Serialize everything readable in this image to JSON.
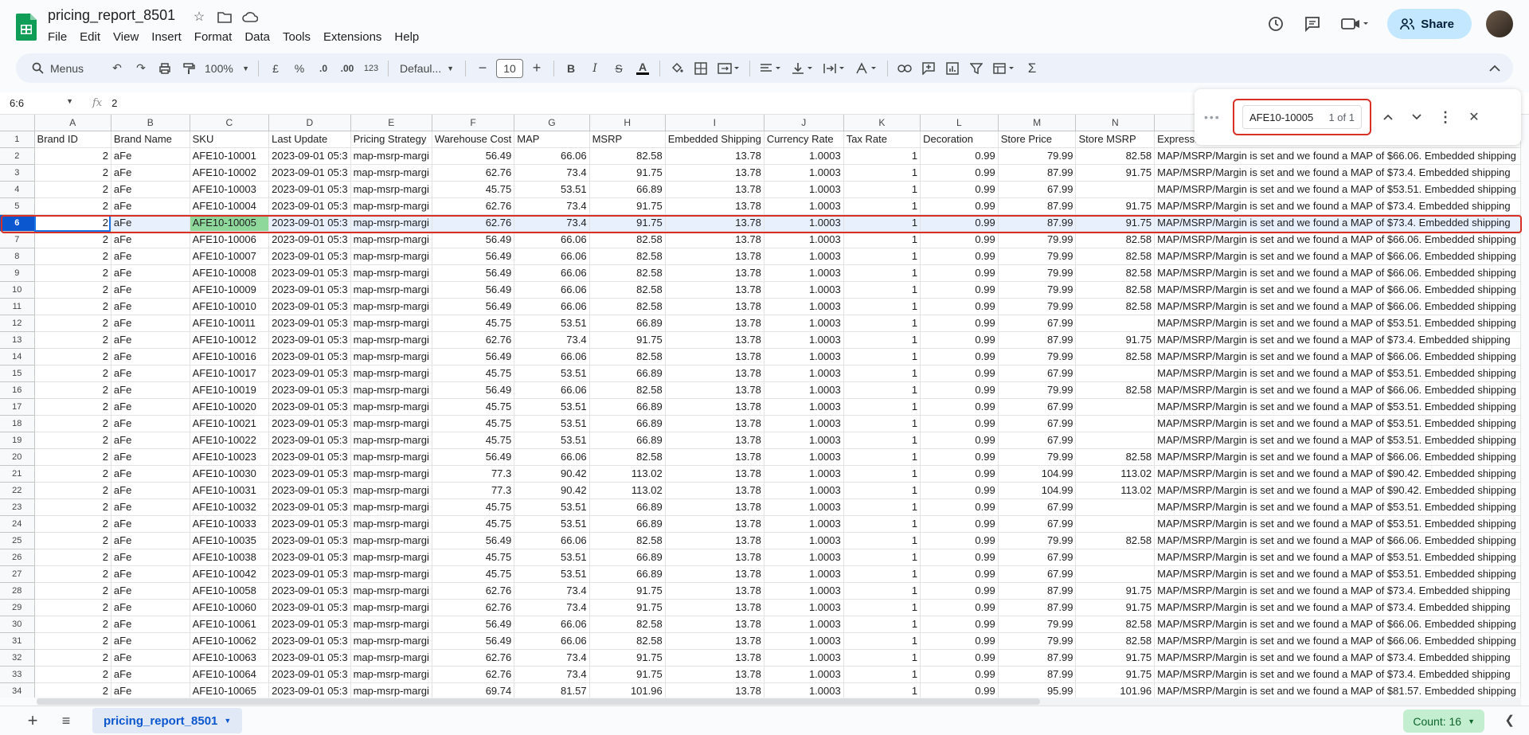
{
  "doc": {
    "title": "pricing_report_8501"
  },
  "menu": [
    "File",
    "Edit",
    "View",
    "Insert",
    "Format",
    "Data",
    "Tools",
    "Extensions",
    "Help"
  ],
  "header": {
    "share_label": "Share"
  },
  "toolbar": {
    "search_label": "Menus",
    "zoom": "100%",
    "currency": "£",
    "percent": "%",
    "dec_dec": ".0",
    "dec_inc": ".00",
    "number_format": "123",
    "font": "Defaul...",
    "font_size": "10"
  },
  "formula": {
    "namebox": "6:6",
    "fx": "fx",
    "value": "2"
  },
  "find": {
    "query": "AFE10-10005",
    "count": "1 of 1"
  },
  "columns": [
    "A",
    "B",
    "C",
    "D",
    "E",
    "F",
    "G",
    "H",
    "I",
    "J",
    "K",
    "L",
    "M",
    "N",
    "O"
  ],
  "header_row": [
    "Brand ID",
    "Brand Name",
    "SKU",
    "Last Update",
    "Pricing Strategy",
    "Warehouse Cost",
    "MAP",
    "MSRP",
    "Embedded Shipping",
    "Currency Rate",
    "Tax Rate",
    "Decoration",
    "Store Price",
    "Store MSRP",
    "Expression"
  ],
  "rows": [
    {
      "n": "2",
      "sku": "AFE10-10001",
      "wc": "56.49",
      "map": "66.06",
      "msrp": "82.58",
      "sp": "79.99",
      "sm": "82.58",
      "ex": "MAP/MSRP/Margin is set and we found a MAP of $66.06. Embedded shipping"
    },
    {
      "n": "3",
      "sku": "AFE10-10002",
      "wc": "62.76",
      "map": "73.4",
      "msrp": "91.75",
      "sp": "87.99",
      "sm": "91.75",
      "ex": "MAP/MSRP/Margin is set and we found a MAP of $73.4. Embedded shipping"
    },
    {
      "n": "4",
      "sku": "AFE10-10003",
      "wc": "45.75",
      "map": "53.51",
      "msrp": "66.89",
      "sp": "67.99",
      "sm": "",
      "ex": "MAP/MSRP/Margin is set and we found a MAP of $53.51. Embedded shipping"
    },
    {
      "n": "5",
      "sku": "AFE10-10004",
      "wc": "62.76",
      "map": "73.4",
      "msrp": "91.75",
      "sp": "87.99",
      "sm": "91.75",
      "ex": "MAP/MSRP/Margin is set and we found a MAP of $73.4. Embedded shipping"
    },
    {
      "n": "6",
      "sku": "AFE10-10005",
      "wc": "62.76",
      "map": "73.4",
      "msrp": "91.75",
      "sp": "87.99",
      "sm": "91.75",
      "ex": "MAP/MSRP/Margin is set and we found a MAP of $73.4. Embedded shipping"
    },
    {
      "n": "7",
      "sku": "AFE10-10006",
      "wc": "56.49",
      "map": "66.06",
      "msrp": "82.58",
      "sp": "79.99",
      "sm": "82.58",
      "ex": "MAP/MSRP/Margin is set and we found a MAP of $66.06. Embedded shipping"
    },
    {
      "n": "8",
      "sku": "AFE10-10007",
      "wc": "56.49",
      "map": "66.06",
      "msrp": "82.58",
      "sp": "79.99",
      "sm": "82.58",
      "ex": "MAP/MSRP/Margin is set and we found a MAP of $66.06. Embedded shipping"
    },
    {
      "n": "9",
      "sku": "AFE10-10008",
      "wc": "56.49",
      "map": "66.06",
      "msrp": "82.58",
      "sp": "79.99",
      "sm": "82.58",
      "ex": "MAP/MSRP/Margin is set and we found a MAP of $66.06. Embedded shipping"
    },
    {
      "n": "10",
      "sku": "AFE10-10009",
      "wc": "56.49",
      "map": "66.06",
      "msrp": "82.58",
      "sp": "79.99",
      "sm": "82.58",
      "ex": "MAP/MSRP/Margin is set and we found a MAP of $66.06. Embedded shipping"
    },
    {
      "n": "11",
      "sku": "AFE10-10010",
      "wc": "56.49",
      "map": "66.06",
      "msrp": "82.58",
      "sp": "79.99",
      "sm": "82.58",
      "ex": "MAP/MSRP/Margin is set and we found a MAP of $66.06. Embedded shipping"
    },
    {
      "n": "12",
      "sku": "AFE10-10011",
      "wc": "45.75",
      "map": "53.51",
      "msrp": "66.89",
      "sp": "67.99",
      "sm": "",
      "ex": "MAP/MSRP/Margin is set and we found a MAP of $53.51. Embedded shipping"
    },
    {
      "n": "13",
      "sku": "AFE10-10012",
      "wc": "62.76",
      "map": "73.4",
      "msrp": "91.75",
      "sp": "87.99",
      "sm": "91.75",
      "ex": "MAP/MSRP/Margin is set and we found a MAP of $73.4. Embedded shipping"
    },
    {
      "n": "14",
      "sku": "AFE10-10016",
      "wc": "56.49",
      "map": "66.06",
      "msrp": "82.58",
      "sp": "79.99",
      "sm": "82.58",
      "ex": "MAP/MSRP/Margin is set and we found a MAP of $66.06. Embedded shipping"
    },
    {
      "n": "15",
      "sku": "AFE10-10017",
      "wc": "45.75",
      "map": "53.51",
      "msrp": "66.89",
      "sp": "67.99",
      "sm": "",
      "ex": "MAP/MSRP/Margin is set and we found a MAP of $53.51. Embedded shipping"
    },
    {
      "n": "16",
      "sku": "AFE10-10019",
      "wc": "56.49",
      "map": "66.06",
      "msrp": "82.58",
      "sp": "79.99",
      "sm": "82.58",
      "ex": "MAP/MSRP/Margin is set and we found a MAP of $66.06. Embedded shipping"
    },
    {
      "n": "17",
      "sku": "AFE10-10020",
      "wc": "45.75",
      "map": "53.51",
      "msrp": "66.89",
      "sp": "67.99",
      "sm": "",
      "ex": "MAP/MSRP/Margin is set and we found a MAP of $53.51. Embedded shipping"
    },
    {
      "n": "18",
      "sku": "AFE10-10021",
      "wc": "45.75",
      "map": "53.51",
      "msrp": "66.89",
      "sp": "67.99",
      "sm": "",
      "ex": "MAP/MSRP/Margin is set and we found a MAP of $53.51. Embedded shipping"
    },
    {
      "n": "19",
      "sku": "AFE10-10022",
      "wc": "45.75",
      "map": "53.51",
      "msrp": "66.89",
      "sp": "67.99",
      "sm": "",
      "ex": "MAP/MSRP/Margin is set and we found a MAP of $53.51. Embedded shipping"
    },
    {
      "n": "20",
      "sku": "AFE10-10023",
      "wc": "56.49",
      "map": "66.06",
      "msrp": "82.58",
      "sp": "79.99",
      "sm": "82.58",
      "ex": "MAP/MSRP/Margin is set and we found a MAP of $66.06. Embedded shipping"
    },
    {
      "n": "21",
      "sku": "AFE10-10030",
      "wc": "77.3",
      "map": "90.42",
      "msrp": "113.02",
      "sp": "104.99",
      "sm": "113.02",
      "ex": "MAP/MSRP/Margin is set and we found a MAP of $90.42. Embedded shipping"
    },
    {
      "n": "22",
      "sku": "AFE10-10031",
      "wc": "77.3",
      "map": "90.42",
      "msrp": "113.02",
      "sp": "104.99",
      "sm": "113.02",
      "ex": "MAP/MSRP/Margin is set and we found a MAP of $90.42. Embedded shipping"
    },
    {
      "n": "23",
      "sku": "AFE10-10032",
      "wc": "45.75",
      "map": "53.51",
      "msrp": "66.89",
      "sp": "67.99",
      "sm": "",
      "ex": "MAP/MSRP/Margin is set and we found a MAP of $53.51. Embedded shipping"
    },
    {
      "n": "24",
      "sku": "AFE10-10033",
      "wc": "45.75",
      "map": "53.51",
      "msrp": "66.89",
      "sp": "67.99",
      "sm": "",
      "ex": "MAP/MSRP/Margin is set and we found a MAP of $53.51. Embedded shipping"
    },
    {
      "n": "25",
      "sku": "AFE10-10035",
      "wc": "56.49",
      "map": "66.06",
      "msrp": "82.58",
      "sp": "79.99",
      "sm": "82.58",
      "ex": "MAP/MSRP/Margin is set and we found a MAP of $66.06. Embedded shipping"
    },
    {
      "n": "26",
      "sku": "AFE10-10038",
      "wc": "45.75",
      "map": "53.51",
      "msrp": "66.89",
      "sp": "67.99",
      "sm": "",
      "ex": "MAP/MSRP/Margin is set and we found a MAP of $53.51. Embedded shipping"
    },
    {
      "n": "27",
      "sku": "AFE10-10042",
      "wc": "45.75",
      "map": "53.51",
      "msrp": "66.89",
      "sp": "67.99",
      "sm": "",
      "ex": "MAP/MSRP/Margin is set and we found a MAP of $53.51. Embedded shipping"
    },
    {
      "n": "28",
      "sku": "AFE10-10058",
      "wc": "62.76",
      "map": "73.4",
      "msrp": "91.75",
      "sp": "87.99",
      "sm": "91.75",
      "ex": "MAP/MSRP/Margin is set and we found a MAP of $73.4. Embedded shipping"
    },
    {
      "n": "29",
      "sku": "AFE10-10060",
      "wc": "62.76",
      "map": "73.4",
      "msrp": "91.75",
      "sp": "87.99",
      "sm": "91.75",
      "ex": "MAP/MSRP/Margin is set and we found a MAP of $73.4. Embedded shipping"
    },
    {
      "n": "30",
      "sku": "AFE10-10061",
      "wc": "56.49",
      "map": "66.06",
      "msrp": "82.58",
      "sp": "79.99",
      "sm": "82.58",
      "ex": "MAP/MSRP/Margin is set and we found a MAP of $66.06. Embedded shipping"
    },
    {
      "n": "31",
      "sku": "AFE10-10062",
      "wc": "56.49",
      "map": "66.06",
      "msrp": "82.58",
      "sp": "79.99",
      "sm": "82.58",
      "ex": "MAP/MSRP/Margin is set and we found a MAP of $66.06. Embedded shipping"
    },
    {
      "n": "32",
      "sku": "AFE10-10063",
      "wc": "62.76",
      "map": "73.4",
      "msrp": "91.75",
      "sp": "87.99",
      "sm": "91.75",
      "ex": "MAP/MSRP/Margin is set and we found a MAP of $73.4. Embedded shipping"
    },
    {
      "n": "33",
      "sku": "AFE10-10064",
      "wc": "62.76",
      "map": "73.4",
      "msrp": "91.75",
      "sp": "87.99",
      "sm": "91.75",
      "ex": "MAP/MSRP/Margin is set and we found a MAP of $73.4. Embedded shipping"
    },
    {
      "n": "34",
      "sku": "AFE10-10065",
      "wc": "69.74",
      "map": "81.57",
      "msrp": "101.96",
      "sp": "95.99",
      "sm": "101.96",
      "ex": "MAP/MSRP/Margin is set and we found a MAP of $81.57. Embedded shipping"
    }
  ],
  "common": {
    "brand_id": "2",
    "brand_name": "aFe",
    "last_update": "2023-09-01 05:3",
    "strategy": "map-msrp-margi",
    "emb_ship": "13.78",
    "currency_rate": "1.0003",
    "tax_rate": "1",
    "decoration": "0.99"
  },
  "selected_row": "6",
  "bottom": {
    "sheet_name": "pricing_report_8501",
    "count": "Count: 16"
  },
  "colors": {
    "accent": "#0b57d0",
    "share_bg": "#c2e7ff",
    "found": "#8fd89c",
    "highlight": "#d93025",
    "count_bg": "#c4eed0"
  }
}
